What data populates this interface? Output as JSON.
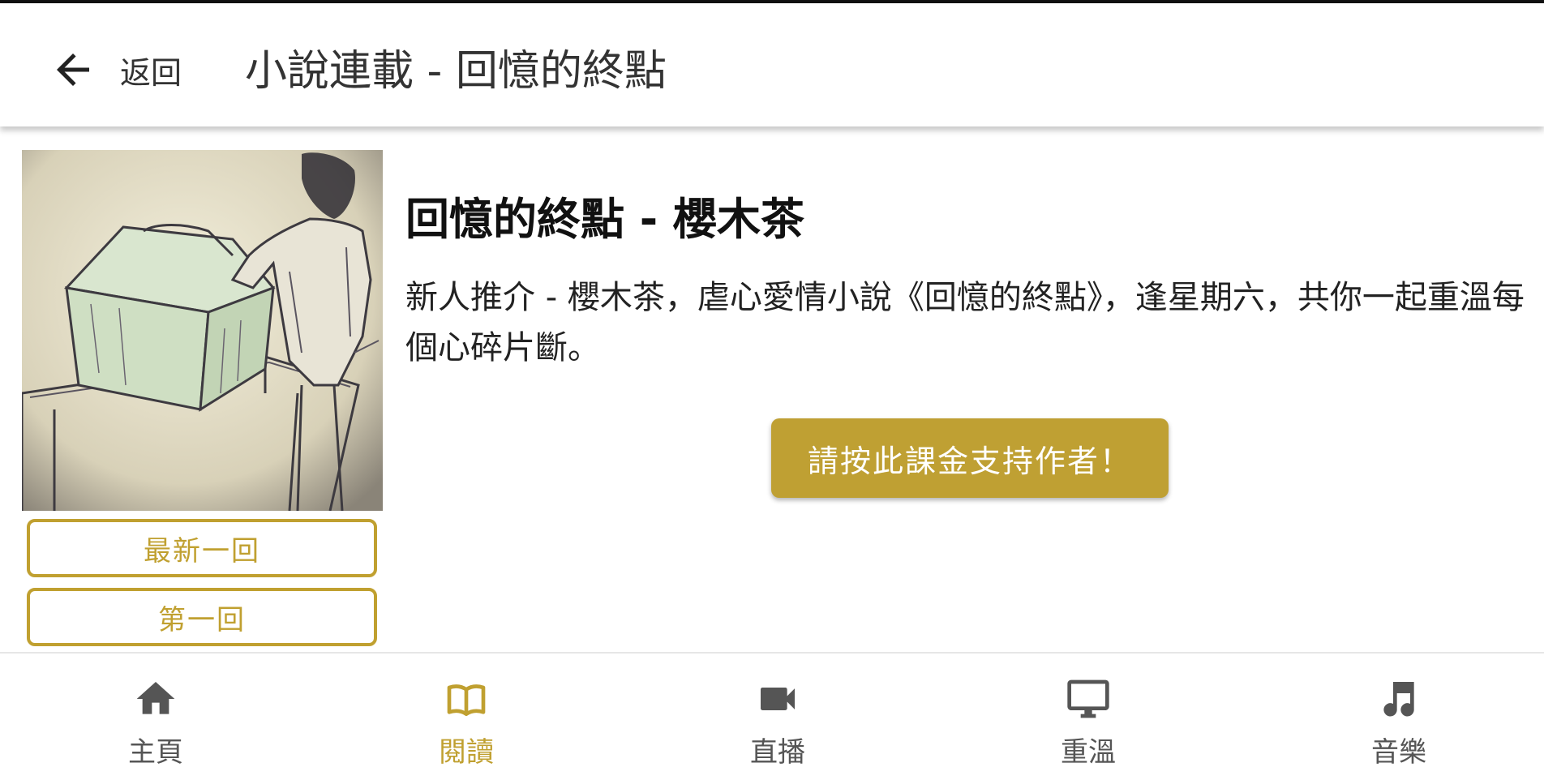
{
  "header": {
    "back_label": "返回",
    "title": "小說連載 - 回憶的終點"
  },
  "novel": {
    "title": "回憶的終點 - 櫻木茶",
    "description": "新人推介 - 櫻木茶，虐心愛情小說《回憶的終點》，逢星期六，共你一起重溫每個心碎片斷。",
    "support_label": "請按此課金支持作者！",
    "latest_label": "最新一回",
    "first_label": "第一回"
  },
  "nav": {
    "items": [
      {
        "label": "主頁",
        "icon": "home-icon"
      },
      {
        "label": "閱讀",
        "icon": "book-icon",
        "active": true
      },
      {
        "label": "直播",
        "icon": "video-camera-icon"
      },
      {
        "label": "重溫",
        "icon": "monitor-icon"
      },
      {
        "label": "音樂",
        "icon": "music-note-icon"
      }
    ]
  },
  "colors": {
    "accent": "#c0a030",
    "button_bg": "#bfa033",
    "inactive_icon": "#555555"
  }
}
